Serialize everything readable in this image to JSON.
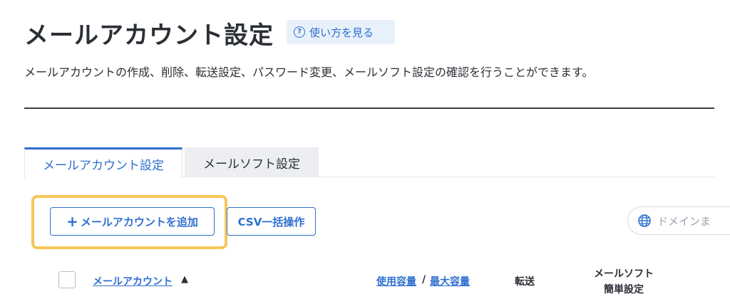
{
  "header": {
    "title": "メールアカウント設定",
    "help_label": "使い方を見る",
    "help_icon": "question-circle-icon",
    "description": "メールアカウントの作成、削除、転送設定、パスワード変更、メールソフト設定の確認を行うことができます。"
  },
  "tabs": [
    {
      "label": "メールアカウント設定",
      "active": true
    },
    {
      "label": "メールソフト設定",
      "active": false
    }
  ],
  "toolbar": {
    "add_icon": "plus-icon",
    "add_label": "メールアカウントを追加",
    "csv_label": "CSV一括操作",
    "domain_placeholder": "ドメインま",
    "domain_icon": "globe-icon",
    "highlight_color": "#f7c65a"
  },
  "table": {
    "col_account": "メールアカウント",
    "sort_indicator": "▲",
    "col_usage": "使用容量",
    "col_separator": "/",
    "col_max": "最大容量",
    "col_forward": "転送",
    "col_soft_line1": "メールソフト",
    "col_soft_line2": "簡単設定"
  },
  "colors": {
    "accent": "#2f6fcf",
    "text": "#2b2f36",
    "help_bg": "#e8f1fb"
  }
}
